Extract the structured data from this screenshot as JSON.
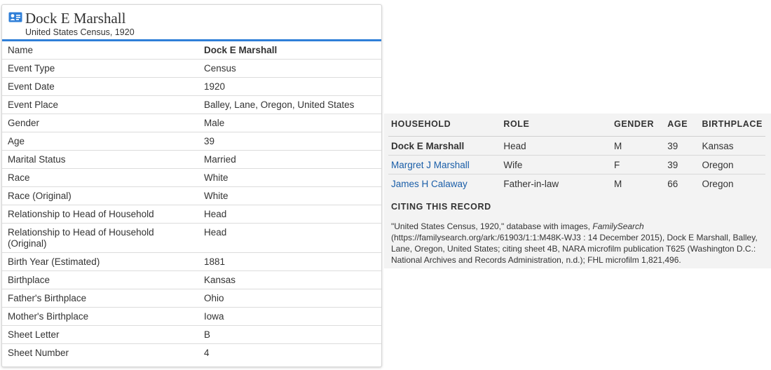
{
  "record": {
    "title": "Dock E Marshall",
    "subtitle": "United States Census, 1920",
    "icon": "person-card-icon",
    "accent_color": "#2f7fd8",
    "fields": [
      {
        "label": "Name",
        "value": "Dock E Marshall"
      },
      {
        "label": "Event Type",
        "value": "Census"
      },
      {
        "label": "Event Date",
        "value": "1920"
      },
      {
        "label": "Event Place",
        "value": "Balley, Lane, Oregon, United States"
      },
      {
        "label": "Gender",
        "value": "Male"
      },
      {
        "label": "Age",
        "value": "39"
      },
      {
        "label": "Marital Status",
        "value": "Married"
      },
      {
        "label": "Race",
        "value": "White"
      },
      {
        "label": "Race (Original)",
        "value": "White"
      },
      {
        "label": "Relationship to Head of Household",
        "value": "Head"
      },
      {
        "label": "Relationship to Head of Household (Original)",
        "value": "Head"
      },
      {
        "label": "Birth Year (Estimated)",
        "value": "1881"
      },
      {
        "label": "Birthplace",
        "value": "Kansas"
      },
      {
        "label": "Father's Birthplace",
        "value": "Ohio"
      },
      {
        "label": "Mother's Birthplace",
        "value": "Iowa"
      },
      {
        "label": "Sheet Letter",
        "value": "B"
      },
      {
        "label": "Sheet Number",
        "value": "4"
      }
    ]
  },
  "household": {
    "headers": [
      "HOUSEHOLD",
      "ROLE",
      "GENDER",
      "AGE",
      "BIRTHPLACE"
    ],
    "link_color": "#1a5ea8",
    "rows": [
      {
        "name": "Dock E Marshall",
        "role": "Head",
        "gender": "M",
        "age": "39",
        "birthplace": "Kansas",
        "is_self": true
      },
      {
        "name": "Margret J Marshall",
        "role": "Wife",
        "gender": "F",
        "age": "39",
        "birthplace": "Oregon",
        "is_self": false
      },
      {
        "name": "James H Calaway",
        "role": "Father-in-law",
        "gender": "M",
        "age": "66",
        "birthplace": "Oregon",
        "is_self": false
      }
    ]
  },
  "citing": {
    "heading": "CITING THIS RECORD",
    "text_before": "\"United States Census, 1920,\" database with images, ",
    "text_italic": "FamilySearch",
    "text_after": " (https://familysearch.org/ark:/61903/1:1:M48K-WJ3 : 14 December 2015), Dock E Marshall, Balley, Lane, Oregon, United States; citing sheet 4B, NARA microfilm publication T625 (Washington D.C.: National Archives and Records Administration, n.d.); FHL microfilm 1,821,496."
  }
}
